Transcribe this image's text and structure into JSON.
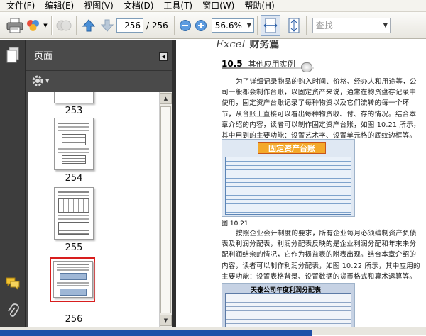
{
  "menus": [
    "文件(F)",
    "编辑(E)",
    "视图(V)",
    "文档(D)",
    "工具(T)",
    "窗口(W)",
    "帮助(H)"
  ],
  "toolbar": {
    "page_current": "256",
    "page_total": "/ 256",
    "zoom": "56.6%",
    "search_placeholder": "查找"
  },
  "nav_panel": {
    "title": "页面",
    "thumbnails": [
      {
        "page": "253",
        "selected": false
      },
      {
        "page": "254",
        "selected": false
      },
      {
        "page": "255",
        "selected": false
      },
      {
        "page": "256",
        "selected": true
      }
    ]
  },
  "document": {
    "header_word": "Excel",
    "header_suffix": "财务篇",
    "section_number": "10.5",
    "section_title": "其他应用实例",
    "paragraph1": "为了详细记录物品的购入时间、价格、经办人和用途等，公司一般都会制作台账，以固定资产来说，通常在物资盘存记录中使用，固定资产台账记录了每种物资以及它们流转的每一个环节，从台账上直接可以看出每种物资收、付、存的情况。结合本章介绍的内容，读者可以制作固定资产台账，如图 10.21 所示，其中用到的主要功能：设置艺术字、设置单元格的底纹边框等。",
    "figure1_title": "固定资产台账",
    "figure1_caption": "图 10.21",
    "paragraph2": "按照企业会计制度的要求，所有企业每月必须编制资产负债表及利润分配表，利润分配表反映的是企业利润分配和年末未分配利润结余的情况，它作为损益表的附表出现。结合本章介绍的内容，读者可以制作利润分配表，如图 10.22 所示，其中应用的主要功能：设置表格背景、设置数据的货币格式和算术运算等。",
    "figure2_title": "天泰公司年度利润分配表"
  },
  "colors": {
    "panel_bg": "#4a4a4a",
    "selected_thumb_border": "#d81e1e",
    "fig_title_bg": "#f4a92a"
  }
}
